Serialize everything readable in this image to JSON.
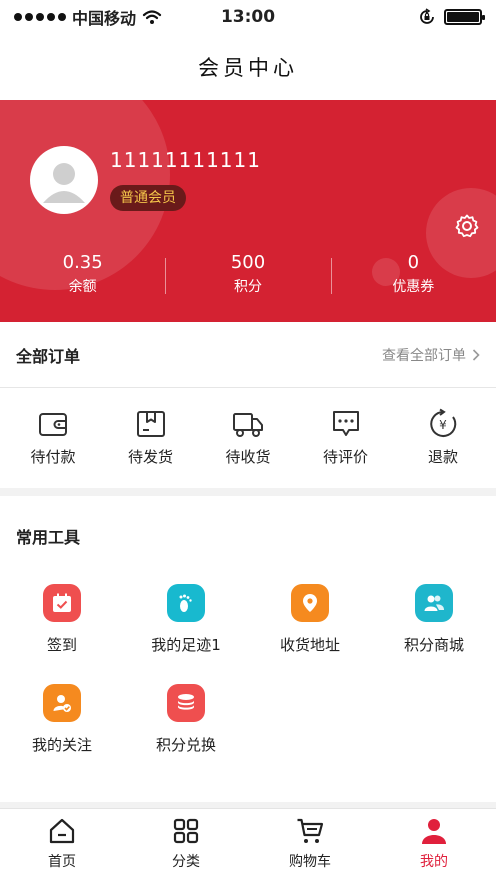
{
  "status_bar": {
    "carrier": "中国移动",
    "time": "13:00"
  },
  "nav": {
    "title": "会员中心"
  },
  "profile": {
    "username": "11111111111",
    "level": "普通会员",
    "stats": [
      {
        "value": "0.35",
        "label": "余额"
      },
      {
        "value": "500",
        "label": "积分"
      },
      {
        "value": "0",
        "label": "优惠券"
      }
    ]
  },
  "orders": {
    "title": "全部订单",
    "more": "查看全部订单",
    "items": [
      {
        "label": "待付款",
        "icon": "wallet-icon"
      },
      {
        "label": "待发货",
        "icon": "package-icon"
      },
      {
        "label": "待收货",
        "icon": "truck-icon"
      },
      {
        "label": "待评价",
        "icon": "comment-icon"
      },
      {
        "label": "退款",
        "icon": "refund-icon"
      }
    ]
  },
  "tools": {
    "title": "常用工具",
    "items": [
      {
        "label": "签到",
        "icon": "calendar-check-icon",
        "color": "#ef4f4f"
      },
      {
        "label": "我的足迹1",
        "icon": "footprint-icon",
        "color": "#18b9cf"
      },
      {
        "label": "收货地址",
        "icon": "location-pin-icon",
        "color": "#f58a1f"
      },
      {
        "label": "积分商城",
        "icon": "users-icon",
        "color": "#1fb6cc"
      },
      {
        "label": "我的关注",
        "icon": "user-follow-icon",
        "color": "#f58a1f"
      },
      {
        "label": "积分兑换",
        "icon": "coins-stack-icon",
        "color": "#ef4f4f"
      }
    ]
  },
  "tabbar": {
    "items": [
      {
        "label": "首页",
        "icon": "home-icon"
      },
      {
        "label": "分类",
        "icon": "grid-icon"
      },
      {
        "label": "购物车",
        "icon": "cart-icon"
      },
      {
        "label": "我的",
        "icon": "profile-icon"
      }
    ],
    "active_color": "#e0203c"
  },
  "colors": {
    "brand_red": "#d42232",
    "badge_text": "#f4c44a"
  }
}
